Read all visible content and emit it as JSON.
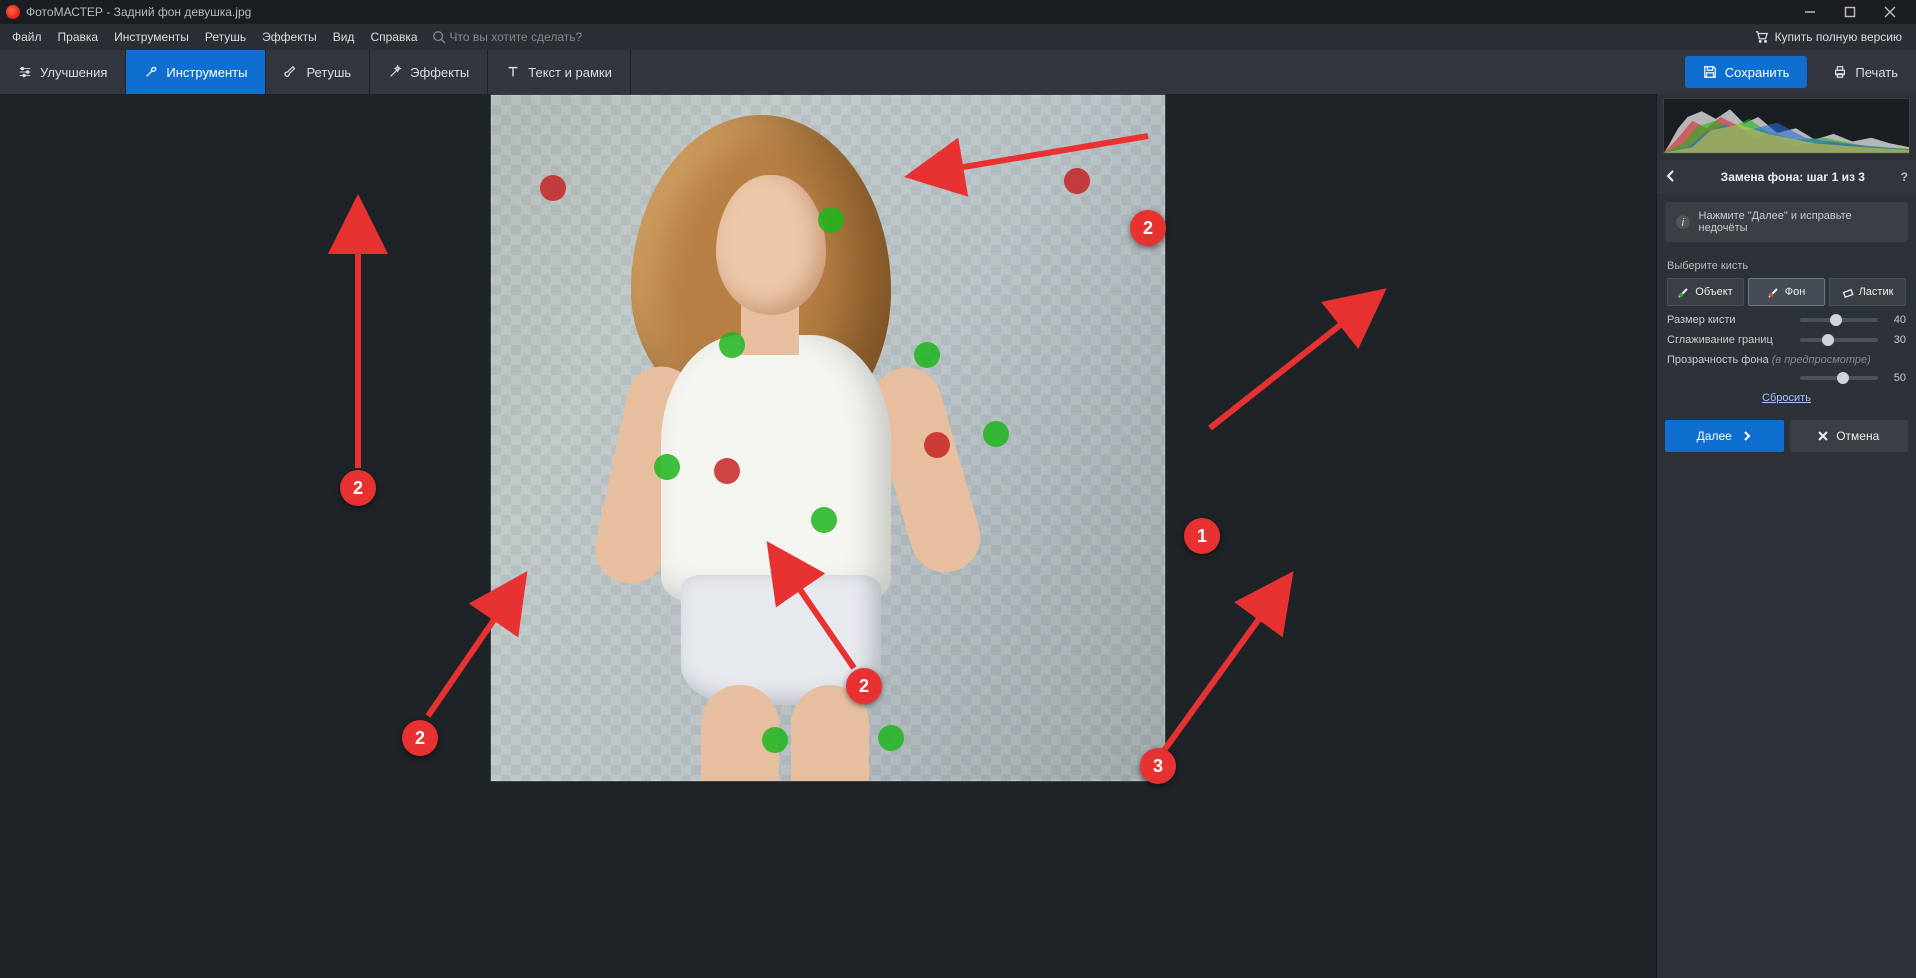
{
  "app": {
    "title": "ФотоМАСТЕР - Задний фон девушка.jpg"
  },
  "window_controls": {
    "minimize": "min",
    "maximize": "max",
    "close": "close"
  },
  "menu": {
    "items": [
      "Файл",
      "Правка",
      "Инструменты",
      "Ретушь",
      "Эффекты",
      "Вид",
      "Справка"
    ],
    "search_placeholder": "Что вы хотите сделать?",
    "buy_full": "Купить полную версию"
  },
  "toolbar": {
    "tabs": [
      {
        "id": "improve",
        "label": "Улучшения",
        "icon": "sliders"
      },
      {
        "id": "tools",
        "label": "Инструменты",
        "icon": "wrench",
        "active": true
      },
      {
        "id": "retouch",
        "label": "Ретушь",
        "icon": "brush"
      },
      {
        "id": "effects",
        "label": "Эффекты",
        "icon": "magic"
      },
      {
        "id": "text",
        "label": "Текст и рамки",
        "icon": "text"
      }
    ],
    "save": "Сохранить",
    "print": "Печать"
  },
  "panel": {
    "title": "Замена фона: шаг 1 из 3",
    "tip": "Нажмите \"Далее\" и исправьте недочёты",
    "brush_label": "Выберите кисть",
    "brushes": [
      {
        "id": "object",
        "label": "Объект",
        "dot": "#1db51d"
      },
      {
        "id": "bg",
        "label": "Фон",
        "dot": "#e24a2a",
        "selected": true
      },
      {
        "id": "eraser",
        "label": "Ластик"
      }
    ],
    "sliders": {
      "brush_size": {
        "label": "Размер кисти",
        "value": 40,
        "min": 1,
        "max": 100
      },
      "smooth": {
        "label": "Сглаживание границ",
        "value": 30,
        "min": 0,
        "max": 100
      },
      "bg_opacity": {
        "label": "Прозрачность фона",
        "note": "(в предпросмотре)",
        "value": 50,
        "min": 0,
        "max": 100
      }
    },
    "reset": "Сбросить",
    "next": "Далее",
    "cancel": "Отмена"
  },
  "annotations": {
    "n1": "1",
    "n2": "2",
    "n3": "3"
  }
}
